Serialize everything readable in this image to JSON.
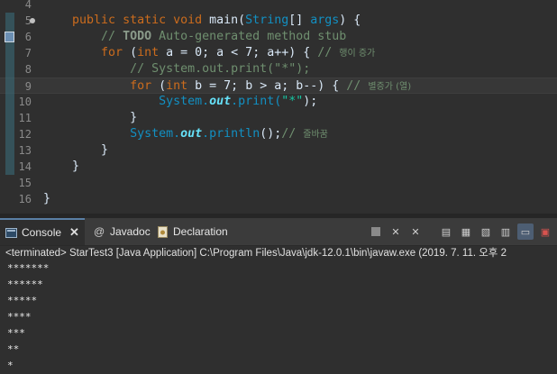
{
  "editor": {
    "line_numbers": [
      "4",
      "5",
      "6",
      "7",
      "8",
      "9",
      "10",
      "11",
      "12",
      "13",
      "14",
      "15",
      "16"
    ],
    "lines": [
      {
        "indent": "",
        "parts": []
      },
      {
        "indent": "    ",
        "parts": [
          [
            "kw",
            "public static void "
          ],
          [
            "pl",
            "main("
          ],
          [
            "ty",
            "String"
          ],
          [
            "pl",
            "[] "
          ],
          [
            "ty",
            "args"
          ],
          [
            "pl",
            ") {"
          ]
        ]
      },
      {
        "indent": "        ",
        "parts": [
          [
            "cm",
            "// "
          ],
          [
            "cmk",
            "TODO"
          ],
          [
            "cm",
            " Auto-generated method stub"
          ]
        ]
      },
      {
        "indent": "        ",
        "parts": [
          [
            "kw",
            "for "
          ],
          [
            "pl",
            "("
          ],
          [
            "kw",
            "int "
          ],
          [
            "pl",
            "a = 0; a < 7; a++) { "
          ],
          [
            "cm",
            "// "
          ],
          [
            "cmko",
            "행이 증가"
          ]
        ]
      },
      {
        "indent": "            ",
        "parts": [
          [
            "cm",
            "// System.out.print(\"*\");"
          ]
        ]
      },
      {
        "indent": "            ",
        "parts": [
          [
            "kw",
            "for "
          ],
          [
            "pl",
            "("
          ],
          [
            "kw",
            "int "
          ],
          [
            "pl",
            "b = 7; b > a; b--) { "
          ],
          [
            "cm",
            "// "
          ],
          [
            "cmko",
            "별증가 (열)"
          ]
        ]
      },
      {
        "indent": "                ",
        "parts": [
          [
            "ty",
            "System."
          ],
          [
            "field",
            "out"
          ],
          [
            "ty",
            ".print("
          ],
          [
            "str",
            "\"*\""
          ],
          [
            "pl",
            ");"
          ]
        ]
      },
      {
        "indent": "            ",
        "parts": [
          [
            "pl",
            "}"
          ]
        ]
      },
      {
        "indent": "            ",
        "parts": [
          [
            "ty",
            "System."
          ],
          [
            "field",
            "out"
          ],
          [
            "ty",
            ".println"
          ],
          [
            "pl",
            "();"
          ],
          [
            "cm",
            "// "
          ],
          [
            "cmko",
            "줄바꿈"
          ]
        ]
      },
      {
        "indent": "        ",
        "parts": [
          [
            "pl",
            "}"
          ]
        ]
      },
      {
        "indent": "    ",
        "parts": [
          [
            "pl",
            "}"
          ]
        ]
      },
      {
        "indent": "",
        "parts": []
      },
      {
        "indent": "",
        "parts": [
          [
            "pl",
            "}"
          ]
        ]
      }
    ]
  },
  "tabs": [
    {
      "label": "Console",
      "icon": "console-icon"
    },
    {
      "label": "Javadoc",
      "icon": "javadoc-icon"
    },
    {
      "label": "Declaration",
      "icon": "declaration-icon"
    }
  ],
  "console": {
    "status": "<terminated> StarTest3 [Java Application] C:\\Program Files\\Java\\jdk-12.0.1\\bin\\javaw.exe (2019. 7. 11. 오후 2",
    "output": [
      "*******",
      "******",
      "*****",
      "****",
      "***",
      "**",
      "*"
    ]
  },
  "colors": {
    "accent": "#5a7fa5",
    "background": "#2f2f2f"
  }
}
